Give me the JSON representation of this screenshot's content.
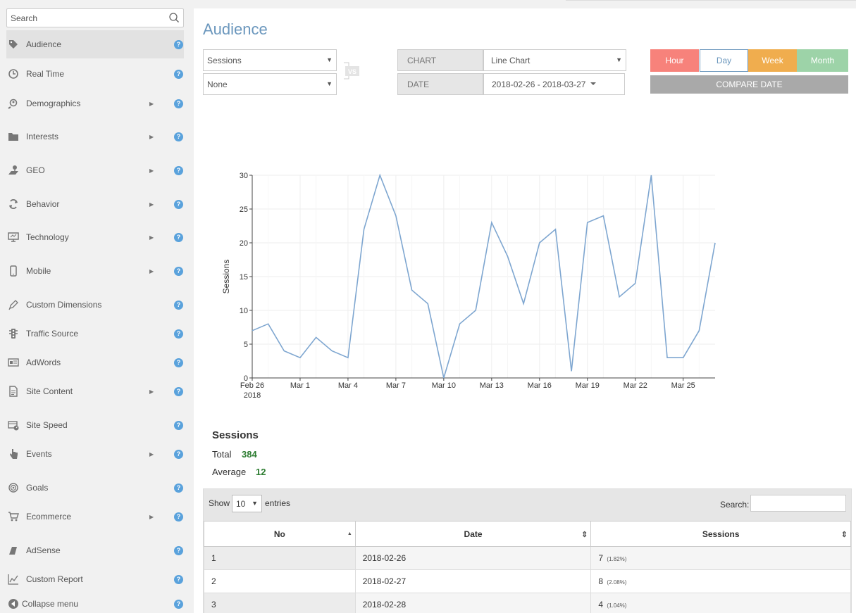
{
  "sidebar": {
    "search_placeholder": "Search",
    "items": [
      {
        "label": "Audience",
        "icon": "tag-icon",
        "arrow": false
      },
      {
        "label": "Real Time",
        "icon": "clock-icon",
        "arrow": false
      },
      {
        "label": "Demographics",
        "icon": "demographics-icon",
        "arrow": true
      },
      {
        "label": "Interests",
        "icon": "folder-icon",
        "arrow": true
      },
      {
        "label": "GEO",
        "icon": "geo-icon",
        "arrow": true
      },
      {
        "label": "Behavior",
        "icon": "refresh-icon",
        "arrow": true
      },
      {
        "label": "Technology",
        "icon": "monitor-icon",
        "arrow": true
      },
      {
        "label": "Mobile",
        "icon": "mobile-icon",
        "arrow": true
      },
      {
        "label": "Custom Dimensions",
        "icon": "pencil-icon",
        "arrow": false
      },
      {
        "label": "Traffic Source",
        "icon": "traffic-light-icon",
        "arrow": false
      },
      {
        "label": "AdWords",
        "icon": "adwords-icon",
        "arrow": false
      },
      {
        "label": "Site Content",
        "icon": "document-icon",
        "arrow": true
      },
      {
        "label": "Site Speed",
        "icon": "speed-icon",
        "arrow": false
      },
      {
        "label": "Events",
        "icon": "hand-pointer-icon",
        "arrow": true
      },
      {
        "label": "Goals",
        "icon": "target-icon",
        "arrow": false
      },
      {
        "label": "Ecommerce",
        "icon": "cart-icon",
        "arrow": true
      },
      {
        "label": "AdSense",
        "icon": "adsense-icon",
        "arrow": false
      },
      {
        "label": "Custom Report",
        "icon": "line-chart-icon",
        "arrow": false
      }
    ],
    "collapse_label": "Collapse menu",
    "help_glyph": "?",
    "arrow_glyph": "▶"
  },
  "main": {
    "title": "Audience",
    "metric_select": "Sessions",
    "compare_select": "None",
    "vs_label": "VS",
    "chart_label": "CHART",
    "chart_type": "Line Chart",
    "date_label": "DATE",
    "date_range": "2018-02-26 - 2018-03-27",
    "period_buttons": {
      "hour": "Hour",
      "day": "Day",
      "week": "Week",
      "month": "Month"
    },
    "compare_date": "COMPARE DATE",
    "caret_glyph": "▼"
  },
  "colors": {
    "accent": "#6b97bd",
    "line": "#7ea6d0",
    "hour": "#f7827b",
    "week": "#f0ad4e",
    "month": "#9dd3a8",
    "positive": "#2e7d32"
  },
  "chart_data": {
    "type": "line",
    "ylabel": "Sessions",
    "xlabel": "",
    "ylim": [
      0,
      30
    ],
    "yticks": [
      0,
      5,
      10,
      15,
      20,
      25,
      30
    ],
    "xtick_labels": [
      "Feb 26",
      "Mar 1",
      "Mar 4",
      "Mar 7",
      "Mar 10",
      "Mar 13",
      "Mar 16",
      "Mar 19",
      "Mar 22",
      "Mar 25"
    ],
    "xtick_year": "2018",
    "x": [
      "2018-02-26",
      "2018-02-27",
      "2018-02-28",
      "2018-03-01",
      "2018-03-02",
      "2018-03-03",
      "2018-03-04",
      "2018-03-05",
      "2018-03-06",
      "2018-03-07",
      "2018-03-08",
      "2018-03-09",
      "2018-03-10",
      "2018-03-11",
      "2018-03-12",
      "2018-03-13",
      "2018-03-14",
      "2018-03-15",
      "2018-03-16",
      "2018-03-17",
      "2018-03-18",
      "2018-03-19",
      "2018-03-20",
      "2018-03-21",
      "2018-03-22",
      "2018-03-23",
      "2018-03-24",
      "2018-03-25",
      "2018-03-26",
      "2018-03-27"
    ],
    "values": [
      7,
      8,
      4,
      3,
      6,
      4,
      3,
      22,
      30,
      24,
      13,
      11,
      0,
      8,
      10,
      23,
      18,
      11,
      20,
      22,
      1,
      23,
      24,
      12,
      14,
      30,
      3,
      3,
      7,
      20
    ],
    "grid": true
  },
  "summary": {
    "title": "Sessions",
    "total_label": "Total",
    "total_value": "384",
    "average_label": "Average",
    "average_value": "12"
  },
  "table": {
    "show_label": "Show",
    "entries_value": "10",
    "entries_label": "entries",
    "search_label": "Search:",
    "columns": [
      "No",
      "Date",
      "Sessions"
    ],
    "sort_asc_glyph": "▲",
    "sort_both_glyph": "⇕",
    "rows": [
      {
        "no": "1",
        "date": "2018-02-26",
        "sessions": "7",
        "pct": "(1.82%)"
      },
      {
        "no": "2",
        "date": "2018-02-27",
        "sessions": "8",
        "pct": "(2.08%)"
      },
      {
        "no": "3",
        "date": "2018-02-28",
        "sessions": "4",
        "pct": "(1.04%)"
      }
    ]
  }
}
